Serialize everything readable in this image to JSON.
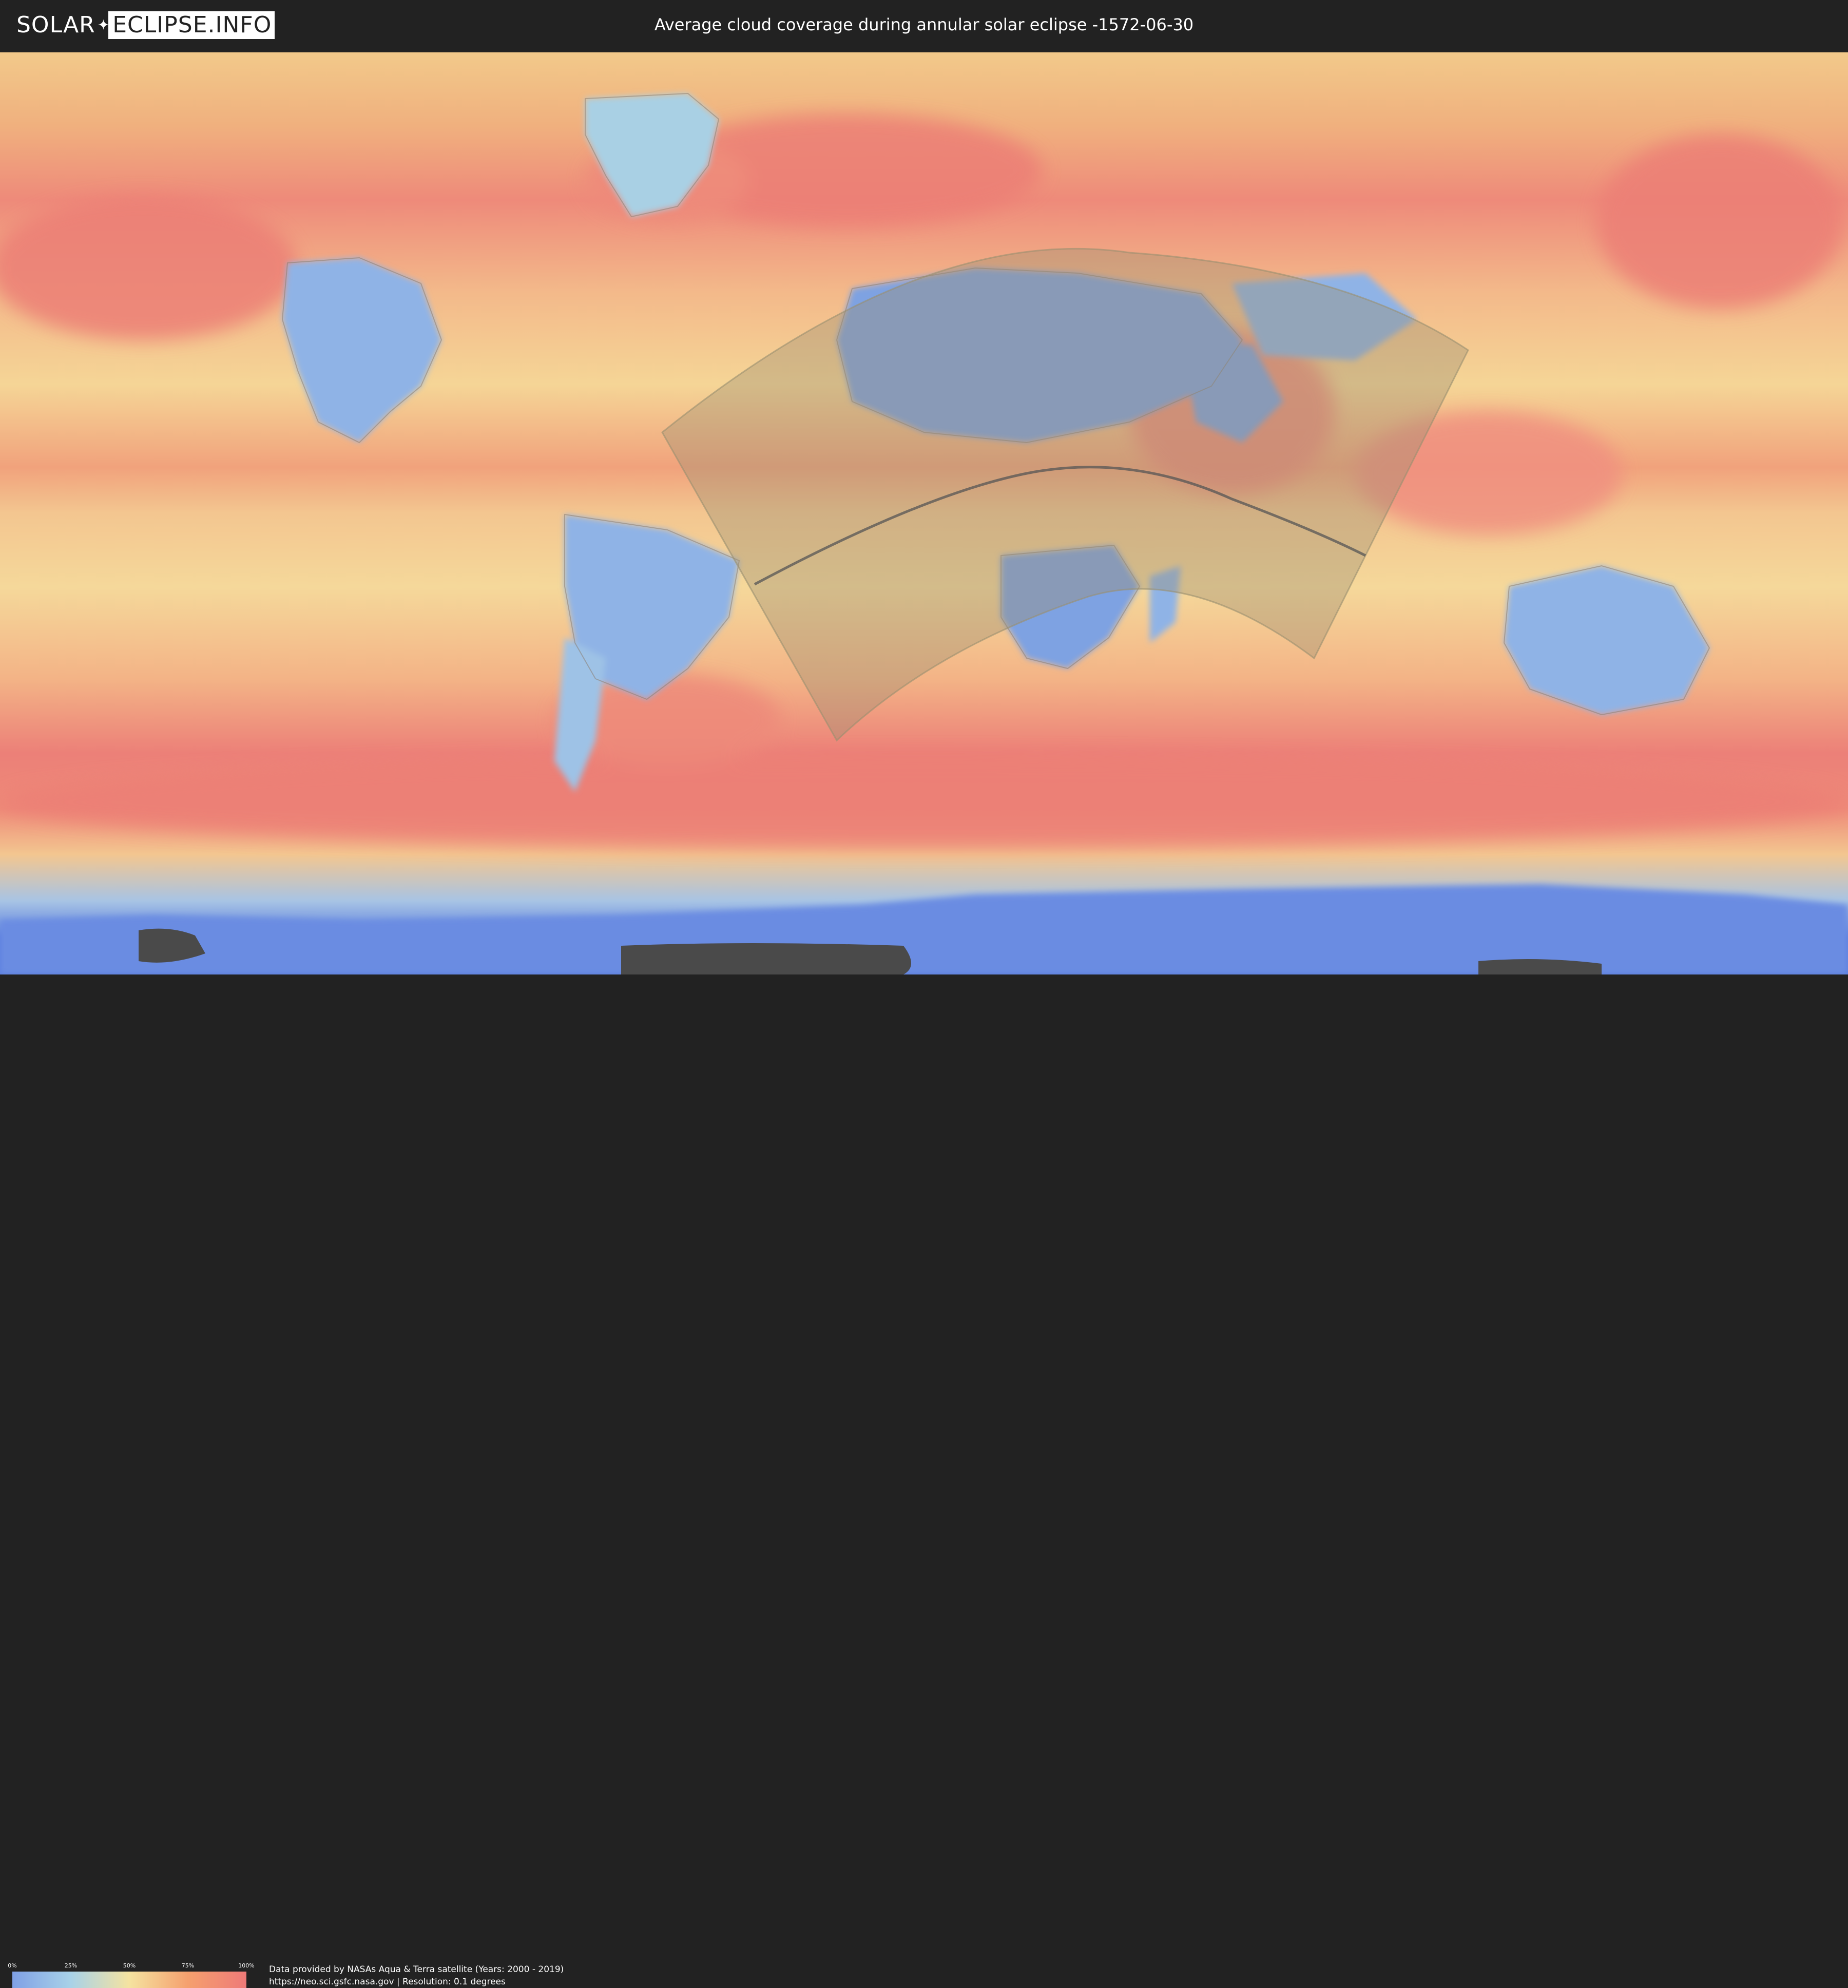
{
  "header": {
    "logo_left": "SOLAR",
    "logo_right": "ECLIPSE.INFO",
    "title": "Average cloud coverage during annular solar eclipse -1572-06-30"
  },
  "map": {
    "type": "cloud-coverage",
    "projection": "equirectangular",
    "colors": {
      "low": "#7fa0e6",
      "mid_low": "#a8d2e8",
      "mid": "#f5e3a0",
      "high": "#ee7a78",
      "eclipse_region": "#9a8f70",
      "central_line": "#555555"
    }
  },
  "legend": {
    "ticks": [
      "0%",
      "25%",
      "50%",
      "75%",
      "100%"
    ],
    "tick_values": [
      0,
      25,
      50,
      75,
      100
    ]
  },
  "footer": {
    "source_line": "Data provided by NASAs Aqua & Terra satellite (Years: 2000 - 2019)",
    "url_line": "https://neo.sci.gsfc.nasa.gov | Resolution: 0.1 degrees"
  }
}
